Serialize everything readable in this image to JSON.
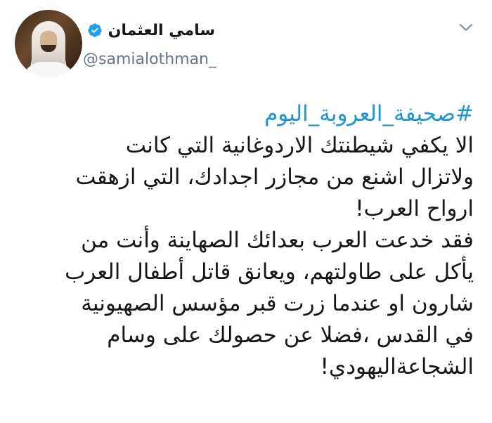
{
  "user": {
    "display_name": "سامي العثمان",
    "handle": "@samialothman_",
    "verified_icon": "verified-badge-icon",
    "avatar_icon": "profile-photo"
  },
  "menu": {
    "icon": "chevron-down-icon"
  },
  "tweet": {
    "hashtag": "#صحيفة_العروبة_اليوم",
    "lines": [
      "الا يكفي شيطنتك الاردوغانية التي كانت",
      "ولاتزال اشنع من مجازر اجدادك، التي ازهقت",
      "ارواح العرب!",
      "فقد خدعت العرب بعدائك الصهاينة وأنت من",
      "يأكل على طاولتهم، ويعانق قاتل أطفال العرب",
      "شارون او عندما زرت قبر مؤسس الصهيونية",
      "في القدس ،فضلا عن حصولك على وسام",
      "الشجاعةاليهودي!"
    ]
  },
  "colors": {
    "link": "#1b95e0",
    "verified": "#1da1f2",
    "text": "#14171a",
    "secondary": "#657786"
  }
}
